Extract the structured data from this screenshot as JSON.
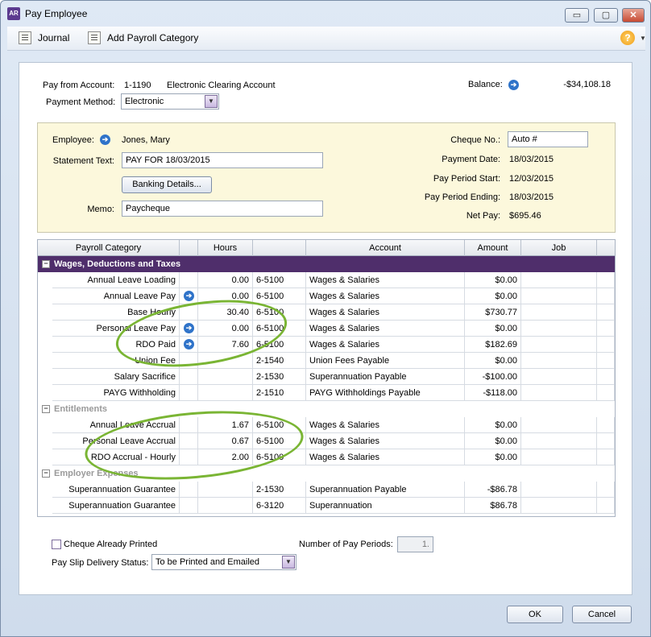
{
  "window": {
    "app_icon": "AR",
    "title": "Pay Employee",
    "minimize": "▭",
    "maximize": "▢",
    "close": "✕"
  },
  "toolbar": {
    "journal": "Journal",
    "add_payroll": "Add Payroll Category",
    "help": "?"
  },
  "header": {
    "pay_from_label": "Pay from Account:",
    "account_number": "1-1190",
    "account_name": "Electronic Clearing Account",
    "balance_label": "Balance:",
    "balance_value": "-$34,108.18",
    "payment_method_label": "Payment Method:",
    "payment_method": "Electronic"
  },
  "employee": {
    "employee_label": "Employee:",
    "employee_name": "Jones, Mary",
    "statement_label": "Statement Text:",
    "statement_text": "PAY FOR 18/03/2015",
    "banking_button": "Banking Details...",
    "memo_label": "Memo:",
    "memo": "Paycheque",
    "cheque_label": "Cheque No.:",
    "cheque_no": "Auto #",
    "payment_date_label": "Payment Date:",
    "payment_date": "18/03/2015",
    "period_start_label": "Pay Period Start:",
    "period_start": "12/03/2015",
    "period_end_label": "Pay Period Ending:",
    "period_end": "18/03/2015",
    "net_pay_label": "Net Pay:",
    "net_pay": "$695.46"
  },
  "grid": {
    "columns": [
      "Payroll Category",
      "Hours",
      "Account",
      "Amount",
      "Job"
    ],
    "sections": [
      {
        "title": "Wages, Deductions and Taxes",
        "toggle": "−",
        "rows": [
          {
            "category": "Annual Leave Loading",
            "arrow": false,
            "hours": "0.00",
            "acct": "6-5100",
            "acct_name": "Wages & Salaries",
            "amount": "$0.00"
          },
          {
            "category": "Annual Leave Pay",
            "arrow": true,
            "hours": "0.00",
            "acct": "6-5100",
            "acct_name": "Wages & Salaries",
            "amount": "$0.00"
          },
          {
            "category": "Base Hourly",
            "arrow": false,
            "hours": "30.40",
            "acct": "6-5100",
            "acct_name": "Wages & Salaries",
            "amount": "$730.77"
          },
          {
            "category": "Personal Leave Pay",
            "arrow": true,
            "hours": "0.00",
            "acct": "6-5100",
            "acct_name": "Wages & Salaries",
            "amount": "$0.00"
          },
          {
            "category": "RDO Paid",
            "arrow": true,
            "hours": "7.60",
            "acct": "6-5100",
            "acct_name": "Wages & Salaries",
            "amount": "$182.69"
          },
          {
            "category": "Union Fee",
            "arrow": false,
            "hours": "",
            "acct": "2-1540",
            "acct_name": "Union Fees Payable",
            "amount": "$0.00"
          },
          {
            "category": "Salary Sacrifice",
            "arrow": false,
            "hours": "",
            "acct": "2-1530",
            "acct_name": "Superannuation Payable",
            "amount": "-$100.00"
          },
          {
            "category": "PAYG Withholding",
            "arrow": false,
            "hours": "",
            "acct": "2-1510",
            "acct_name": "PAYG Withholdings Payable",
            "amount": "-$118.00"
          }
        ]
      },
      {
        "title": "Entitlements",
        "toggle": "−",
        "rows": [
          {
            "category": "Annual Leave Accrual",
            "arrow": false,
            "hours": "1.67",
            "acct": "6-5100",
            "acct_name": "Wages & Salaries",
            "amount": "$0.00"
          },
          {
            "category": "Personal Leave Accrual",
            "arrow": false,
            "hours": "0.67",
            "acct": "6-5100",
            "acct_name": "Wages & Salaries",
            "amount": "$0.00"
          },
          {
            "category": "RDO Accrual - Hourly",
            "arrow": false,
            "hours": "2.00",
            "acct": "6-5100",
            "acct_name": "Wages & Salaries",
            "amount": "$0.00"
          }
        ]
      },
      {
        "title": "Employer Expenses",
        "toggle": "−",
        "rows": [
          {
            "category": "Superannuation Guarantee",
            "arrow": false,
            "hours": "",
            "acct": "2-1530",
            "acct_name": "Superannuation Payable",
            "amount": "-$86.78"
          },
          {
            "category": "Superannuation Guarantee",
            "arrow": false,
            "hours": "",
            "acct": "6-3120",
            "acct_name": "Superannuation",
            "amount": "$86.78"
          }
        ]
      }
    ]
  },
  "footer": {
    "cheque_printed_label": "Cheque Already Printed",
    "pay_periods_label": "Number of Pay Periods:",
    "pay_periods": "1.",
    "delivery_label": "Pay Slip Delivery Status:",
    "delivery_value": "To be Printed and Emailed",
    "ok": "OK",
    "cancel": "Cancel"
  },
  "colors": {
    "section_bar": "#4f2e6b",
    "panel_bg": "#fcf8dc",
    "annotation_circle": "#7ab534",
    "arrow_icon": "#2f73c9"
  }
}
